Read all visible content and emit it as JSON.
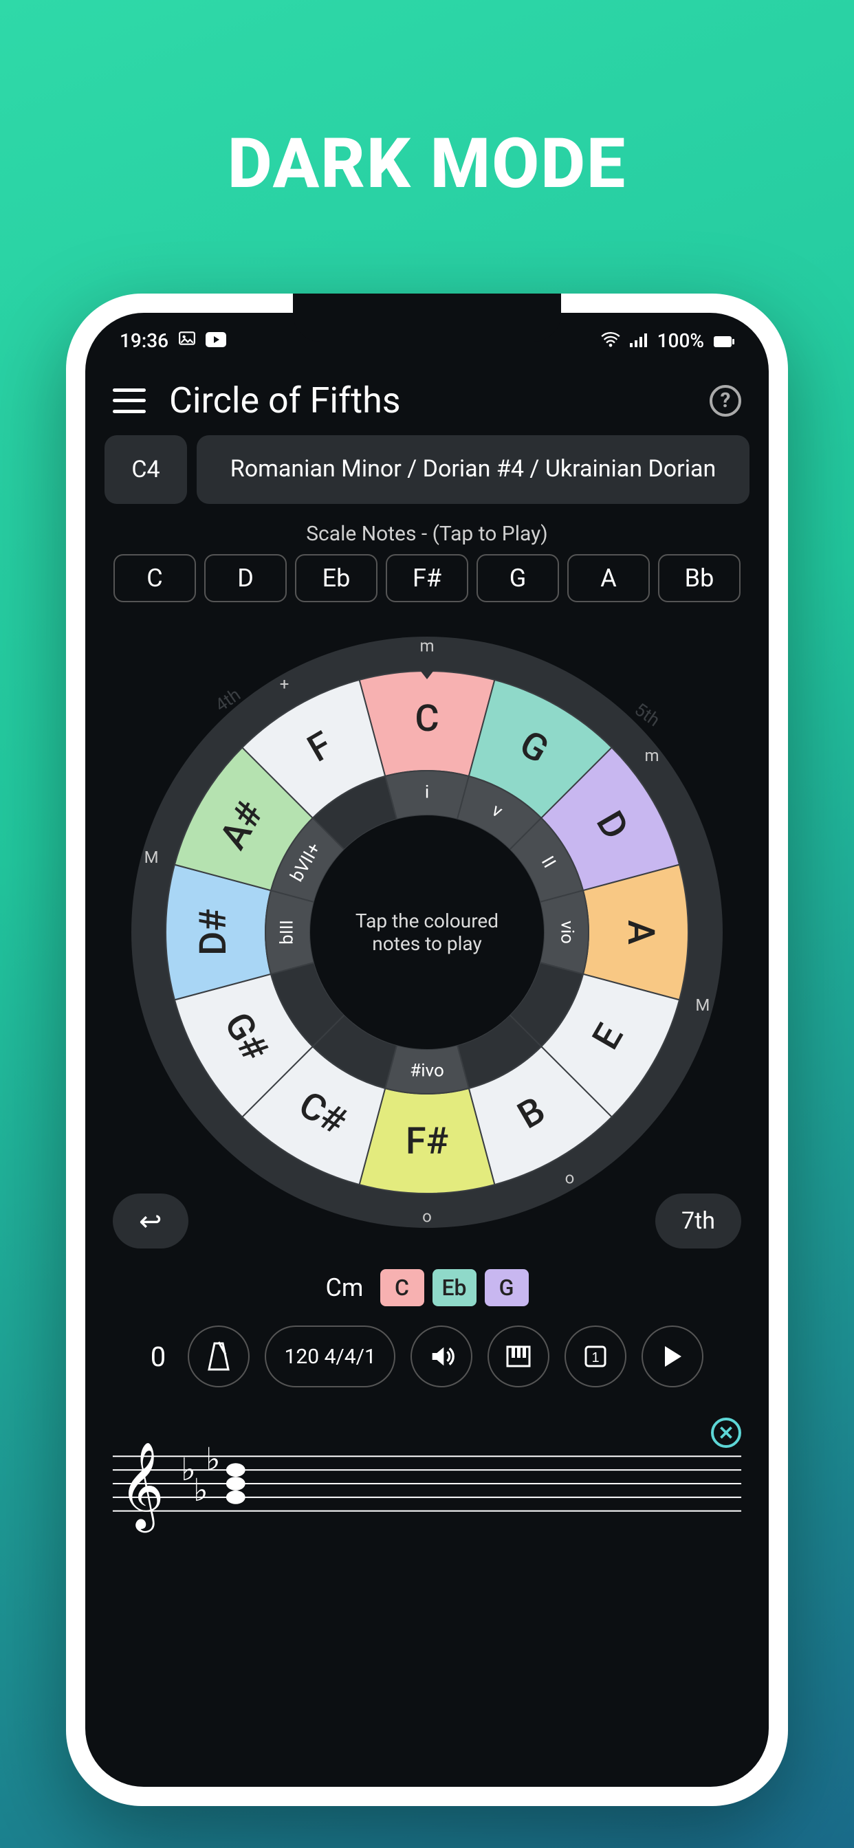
{
  "promo": {
    "title": "DARK MODE"
  },
  "status": {
    "time": "19:36",
    "battery": "100%"
  },
  "app": {
    "title": "Circle of Fifths"
  },
  "selectors": {
    "root": "C4",
    "scale": "Romanian Minor / Dorian #4 / Ukrainian Dorian"
  },
  "scale_section": {
    "label": "Scale Notes - (Tap to Play)",
    "notes": [
      "C",
      "D",
      "Eb",
      "F#",
      "G",
      "A",
      "Bb"
    ]
  },
  "wheel": {
    "outer_labels": [
      "m",
      "",
      "m",
      "",
      "M",
      "",
      "o",
      "",
      "o",
      "",
      "",
      "",
      "",
      "",
      "",
      "M",
      "",
      "+"
    ],
    "notes": [
      "C",
      "G",
      "D",
      "A",
      "E",
      "B",
      "F#",
      "C#",
      "G#",
      "D#",
      "A#",
      "F"
    ],
    "inner": [
      "i",
      "v",
      "II",
      "vio",
      "",
      "",
      "#ivo",
      "",
      "",
      "bIII",
      "bVII+",
      ""
    ],
    "center_text": "Tap the coloured notes to play",
    "arrows": {
      "left": "4th",
      "right": "5th"
    }
  },
  "wheel_buttons": {
    "undo": "↩",
    "seventh": "7th"
  },
  "chord": {
    "name": "Cm",
    "chips": [
      {
        "label": "C",
        "color": "#f7b1b1"
      },
      {
        "label": "Eb",
        "color": "#8fd9c9"
      },
      {
        "label": "G",
        "color": "#c8b7f0"
      }
    ]
  },
  "controls": {
    "count": "0",
    "tempo_sig": "120 4/4/1"
  },
  "colors": {
    "seg": {
      "C": "#f7b1b1",
      "G": "#8fd9c9",
      "D": "#c8b7f0",
      "A": "#f8c884",
      "E": "#eef1f4",
      "B": "#eef1f4",
      "F#": "#e3eb7e",
      "C#": "#eef1f4",
      "G#": "#eef1f4",
      "D#": "#a9d6f5",
      "A#": "#b5e2b0",
      "F": "#eef1f4"
    }
  }
}
